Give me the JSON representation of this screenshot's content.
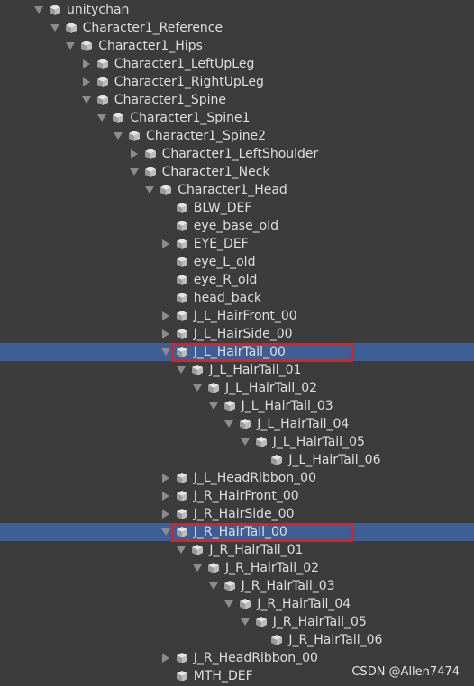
{
  "tree": {
    "nodes": [
      {
        "label": "unitychan",
        "depth": 0,
        "arrow": "expanded"
      },
      {
        "label": "Character1_Reference",
        "depth": 1,
        "arrow": "expanded"
      },
      {
        "label": "Character1_Hips",
        "depth": 2,
        "arrow": "expanded"
      },
      {
        "label": "Character1_LeftUpLeg",
        "depth": 3,
        "arrow": "collapsed"
      },
      {
        "label": "Character1_RightUpLeg",
        "depth": 3,
        "arrow": "collapsed"
      },
      {
        "label": "Character1_Spine",
        "depth": 3,
        "arrow": "expanded"
      },
      {
        "label": "Character1_Spine1",
        "depth": 4,
        "arrow": "expanded"
      },
      {
        "label": "Character1_Spine2",
        "depth": 5,
        "arrow": "expanded"
      },
      {
        "label": "Character1_LeftShoulder",
        "depth": 6,
        "arrow": "collapsed"
      },
      {
        "label": "Character1_Neck",
        "depth": 6,
        "arrow": "expanded"
      },
      {
        "label": "Character1_Head",
        "depth": 7,
        "arrow": "expanded"
      },
      {
        "label": "BLW_DEF",
        "depth": 8,
        "arrow": "none"
      },
      {
        "label": "eye_base_old",
        "depth": 8,
        "arrow": "none"
      },
      {
        "label": "EYE_DEF",
        "depth": 8,
        "arrow": "collapsed"
      },
      {
        "label": "eye_L_old",
        "depth": 8,
        "arrow": "none"
      },
      {
        "label": "eye_R_old",
        "depth": 8,
        "arrow": "none"
      },
      {
        "label": "head_back",
        "depth": 8,
        "arrow": "none"
      },
      {
        "label": "J_L_HairFront_00",
        "depth": 8,
        "arrow": "collapsed"
      },
      {
        "label": "J_L_HairSide_00",
        "depth": 8,
        "arrow": "collapsed"
      },
      {
        "label": "J_L_HairTail_00",
        "depth": 8,
        "arrow": "expanded",
        "selected": true
      },
      {
        "label": "J_L_HairTail_01",
        "depth": 9,
        "arrow": "expanded"
      },
      {
        "label": "J_L_HairTail_02",
        "depth": 10,
        "arrow": "expanded"
      },
      {
        "label": "J_L_HairTail_03",
        "depth": 11,
        "arrow": "expanded"
      },
      {
        "label": "J_L_HairTail_04",
        "depth": 12,
        "arrow": "expanded"
      },
      {
        "label": "J_L_HairTail_05",
        "depth": 13,
        "arrow": "expanded"
      },
      {
        "label": "J_L_HairTail_06",
        "depth": 14,
        "arrow": "none"
      },
      {
        "label": "J_L_HeadRibbon_00",
        "depth": 8,
        "arrow": "collapsed"
      },
      {
        "label": "J_R_HairFront_00",
        "depth": 8,
        "arrow": "collapsed"
      },
      {
        "label": "J_R_HairSide_00",
        "depth": 8,
        "arrow": "collapsed"
      },
      {
        "label": "J_R_HairTail_00",
        "depth": 8,
        "arrow": "expanded",
        "selected": true
      },
      {
        "label": "J_R_HairTail_01",
        "depth": 9,
        "arrow": "expanded"
      },
      {
        "label": "J_R_HairTail_02",
        "depth": 10,
        "arrow": "expanded"
      },
      {
        "label": "J_R_HairTail_03",
        "depth": 11,
        "arrow": "expanded"
      },
      {
        "label": "J_R_HairTail_04",
        "depth": 12,
        "arrow": "expanded"
      },
      {
        "label": "J_R_HairTail_05",
        "depth": 13,
        "arrow": "expanded"
      },
      {
        "label": "J_R_HairTail_06",
        "depth": 14,
        "arrow": "none"
      },
      {
        "label": "J_R_HeadRibbon_00",
        "depth": 8,
        "arrow": "collapsed"
      },
      {
        "label": "MTH_DEF",
        "depth": 8,
        "arrow": "none"
      }
    ]
  },
  "icons": {
    "node": "gameobject-cube-icon",
    "expanded": "triangle-down-icon",
    "collapsed": "triangle-right-icon"
  },
  "colors": {
    "background": "#3c3c3c",
    "selected_row": "#3e5f96",
    "highlight_box": "#e02020"
  },
  "watermark": {
    "text": "CSDN @Allen7474"
  }
}
